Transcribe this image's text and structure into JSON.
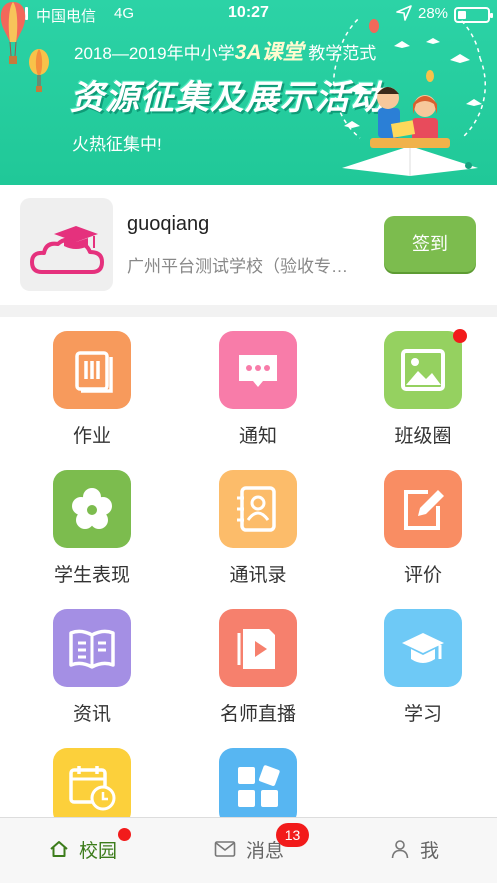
{
  "status_bar": {
    "carrier": "中国电信",
    "network": "4G",
    "time": "10:27",
    "battery_percent": "28%",
    "battery_level": 0.28
  },
  "banner": {
    "line1_prefix": "2018—2019年中小学",
    "line1_highlight": "3A课堂",
    "line1_suffix": " 教学范式",
    "line2": "资源征集及展示活动",
    "line3": "火热征集中!",
    "page_count": 2,
    "active_page": 2
  },
  "profile": {
    "username": "guoqiang",
    "school": "广州平台测试学校（验收专…",
    "checkin_label": "签到"
  },
  "menu": [
    {
      "label": "作业",
      "icon": "homework-book-icon",
      "color": "#f79a5c",
      "badge": false
    },
    {
      "label": "通知",
      "icon": "notice-chat-icon",
      "color": "#f87ca9",
      "badge": false
    },
    {
      "label": "班级圈",
      "icon": "class-circle-image-icon",
      "color": "#95d160",
      "badge": true
    },
    {
      "label": "学生表现",
      "icon": "student-flower-icon",
      "color": "#7cbc4e",
      "badge": false
    },
    {
      "label": "通讯录",
      "icon": "contacts-book-icon",
      "color": "#fcbc6a",
      "badge": false
    },
    {
      "label": "评价",
      "icon": "evaluate-edit-icon",
      "color": "#f98d63",
      "badge": false
    },
    {
      "label": "资讯",
      "icon": "news-book-icon",
      "color": "#a48fe4",
      "badge": false
    },
    {
      "label": "名师直播",
      "icon": "live-play-icon",
      "color": "#f6806d",
      "badge": false
    },
    {
      "label": "学习",
      "icon": "study-cap-icon",
      "color": "#6ec9f6",
      "badge": false
    },
    {
      "label": "",
      "icon": "calendar-clock-icon",
      "color": "#fcd03b",
      "badge": false
    },
    {
      "label": "",
      "icon": "apps-grid-icon",
      "color": "#57b6f2",
      "badge": false
    }
  ],
  "tabbar": {
    "home_label": "校园",
    "messages_label": "消息",
    "messages_count": "13",
    "me_label": "我"
  }
}
